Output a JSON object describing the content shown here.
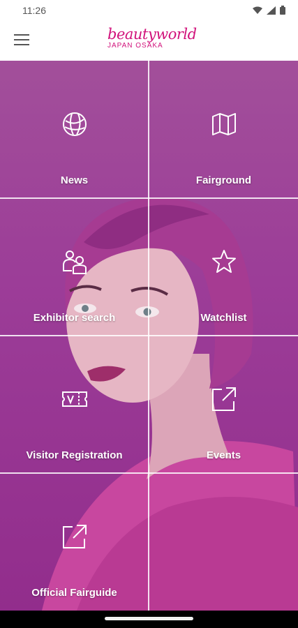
{
  "status_bar": {
    "time": "11:26",
    "icons": [
      "wifi-icon",
      "signal-icon",
      "battery-icon"
    ]
  },
  "header": {
    "menu_icon": "hamburger-menu-icon",
    "brand_name": "beautyworld",
    "brand_sub": "JAPAN OSAKA",
    "brand_color": "#d1127b"
  },
  "tiles": [
    {
      "label": "News",
      "icon": "globe-icon"
    },
    {
      "label": "Fairground",
      "icon": "map-icon"
    },
    {
      "label": "Exhibitor search",
      "icon": "people-icon"
    },
    {
      "label": "Watchlist",
      "icon": "star-icon"
    },
    {
      "label": "Visitor Registration",
      "icon": "visitor-ticket-icon"
    },
    {
      "label": "Events",
      "icon": "external-link-icon"
    },
    {
      "label": "Official Fairguide",
      "icon": "external-link-icon"
    }
  ],
  "colors": {
    "hero_background": "#9c3d98",
    "tile_text": "#ffffff"
  }
}
